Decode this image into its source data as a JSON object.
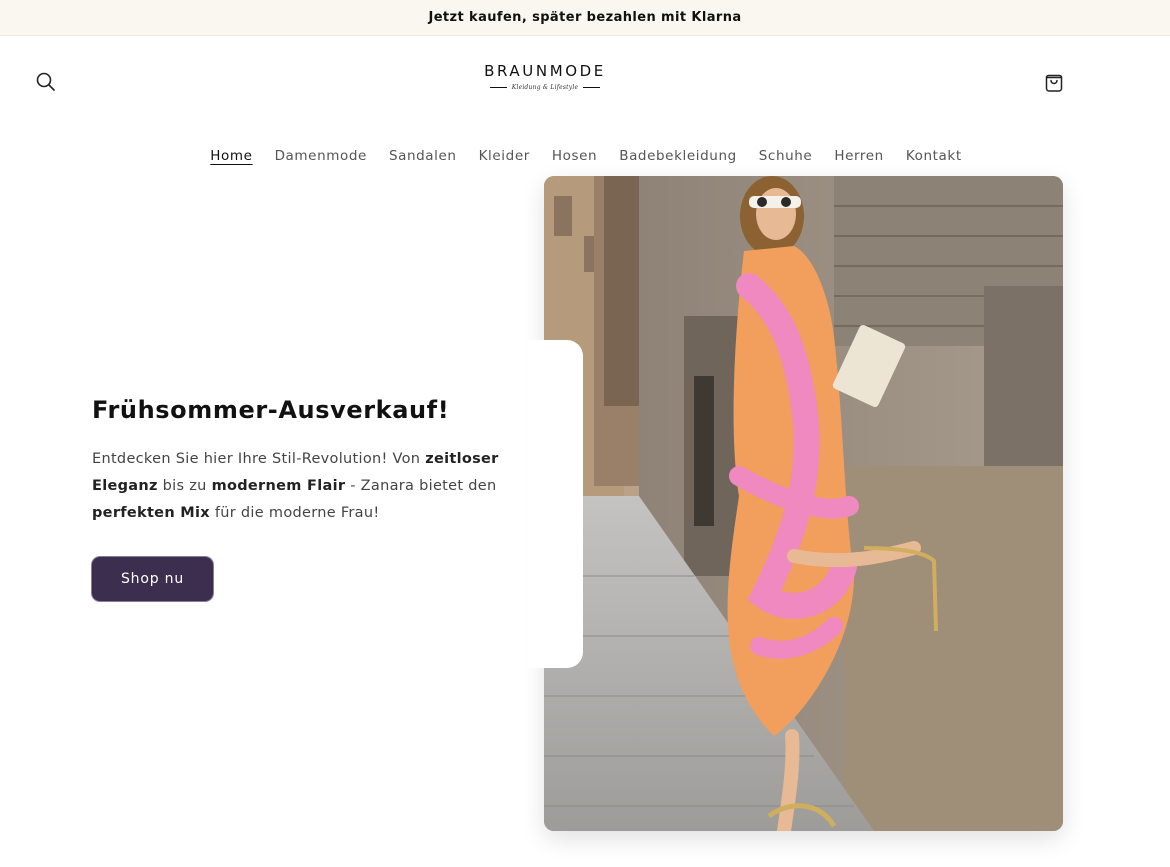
{
  "announcement": {
    "text": "Jetzt kaufen, später bezahlen mit Klarna"
  },
  "header": {
    "logo_title": "BRAUNMODE",
    "logo_tagline": "Kleidung & Lifestyle",
    "search_icon": "search-icon",
    "cart_icon": "shopping-bag-icon"
  },
  "nav": {
    "items": [
      {
        "label": "Home",
        "active": true
      },
      {
        "label": "Damenmode"
      },
      {
        "label": "Sandalen"
      },
      {
        "label": "Kleider"
      },
      {
        "label": "Hosen"
      },
      {
        "label": "Badebekleidung"
      },
      {
        "label": "Schuhe"
      },
      {
        "label": "Herren"
      },
      {
        "label": "Kontakt"
      }
    ]
  },
  "hero": {
    "title": "Frühsommer-Ausverkauf!",
    "text_parts": {
      "p1": "Entdecken Sie hier Ihre Stil-Revolution! Von ",
      "b1": "zeitloser Eleganz",
      "p2": " bis zu ",
      "b2": "modernem Flair",
      "p3": " - Zanara bietet den ",
      "b3": "perfekten Mix",
      "p4": " für die moderne Frau!"
    },
    "button_label": "Shop nu",
    "accent_color": "#3c2e4f"
  }
}
